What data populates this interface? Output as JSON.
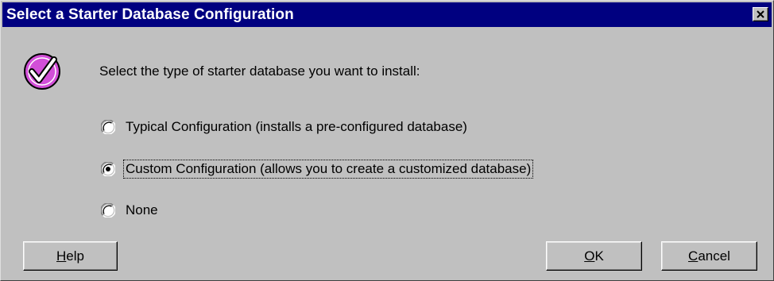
{
  "dialog": {
    "title": "Select a Starter Database Configuration",
    "prompt": "Select the type of starter database you want to install:"
  },
  "options": [
    {
      "label": "Typical Configuration (installs a pre-configured database)",
      "selected": false
    },
    {
      "label": "Custom Configuration (allows you to create a customized database)",
      "selected": true
    },
    {
      "label": "None",
      "selected": false
    }
  ],
  "buttons": {
    "help": {
      "mnemonic": "H",
      "rest": "elp"
    },
    "ok": {
      "mnemonic": "O",
      "rest": "K"
    },
    "cancel": {
      "mnemonic": "C",
      "rest": "ancel"
    }
  },
  "icons": {
    "title_close": "close-icon",
    "dialog_icon": "checkmark-icon"
  },
  "colors": {
    "titlebar": "#000080",
    "dialog_bg": "#c0c0c0",
    "check_icon": "#d24fd8"
  }
}
